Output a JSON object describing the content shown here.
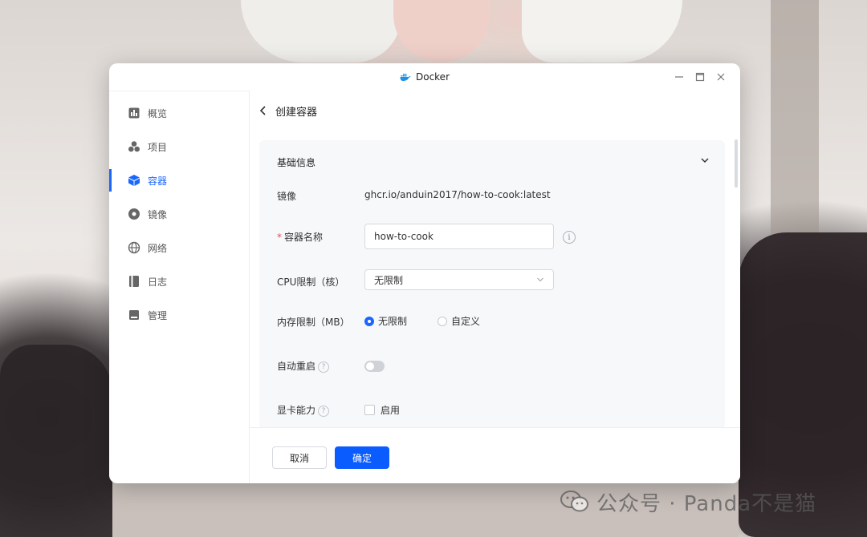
{
  "app": {
    "title": "Docker",
    "window_controls": [
      "minimize-icon",
      "maximize-icon",
      "close-icon"
    ]
  },
  "sidebar": {
    "items": [
      {
        "label": "概览",
        "icon": "overview-icon",
        "active": false
      },
      {
        "label": "项目",
        "icon": "project-icon",
        "active": false
      },
      {
        "label": "容器",
        "icon": "container-icon",
        "active": true
      },
      {
        "label": "镜像",
        "icon": "image-icon",
        "active": false
      },
      {
        "label": "网络",
        "icon": "network-icon",
        "active": false
      },
      {
        "label": "日志",
        "icon": "log-icon",
        "active": false
      },
      {
        "label": "管理",
        "icon": "manage-icon",
        "active": false
      }
    ]
  },
  "page": {
    "title": "创建容器",
    "section": {
      "title": "基础信息",
      "image_label": "镜像",
      "image_value": "ghcr.io/anduin2017/how-to-cook:latest",
      "name_required_mark": "*",
      "name_label": "容器名称",
      "name_value": "how-to-cook",
      "cpu_label": "CPU限制（核）",
      "cpu_value": "无限制",
      "memory_label": "内存限制（MB）",
      "memory_options": [
        "无限制",
        "自定义"
      ],
      "memory_selected": "无限制",
      "restart_label": "自动重启",
      "restart_enabled": false,
      "gpu_label": "显卡能力",
      "gpu_option": "启用",
      "gpu_checked": false
    }
  },
  "footer": {
    "cancel_label": "取消",
    "confirm_label": "确定"
  },
  "watermark": {
    "text": "公众号 · Panda不是猫"
  },
  "colors": {
    "accent": "#0a5cff",
    "required": "#e34d59"
  }
}
